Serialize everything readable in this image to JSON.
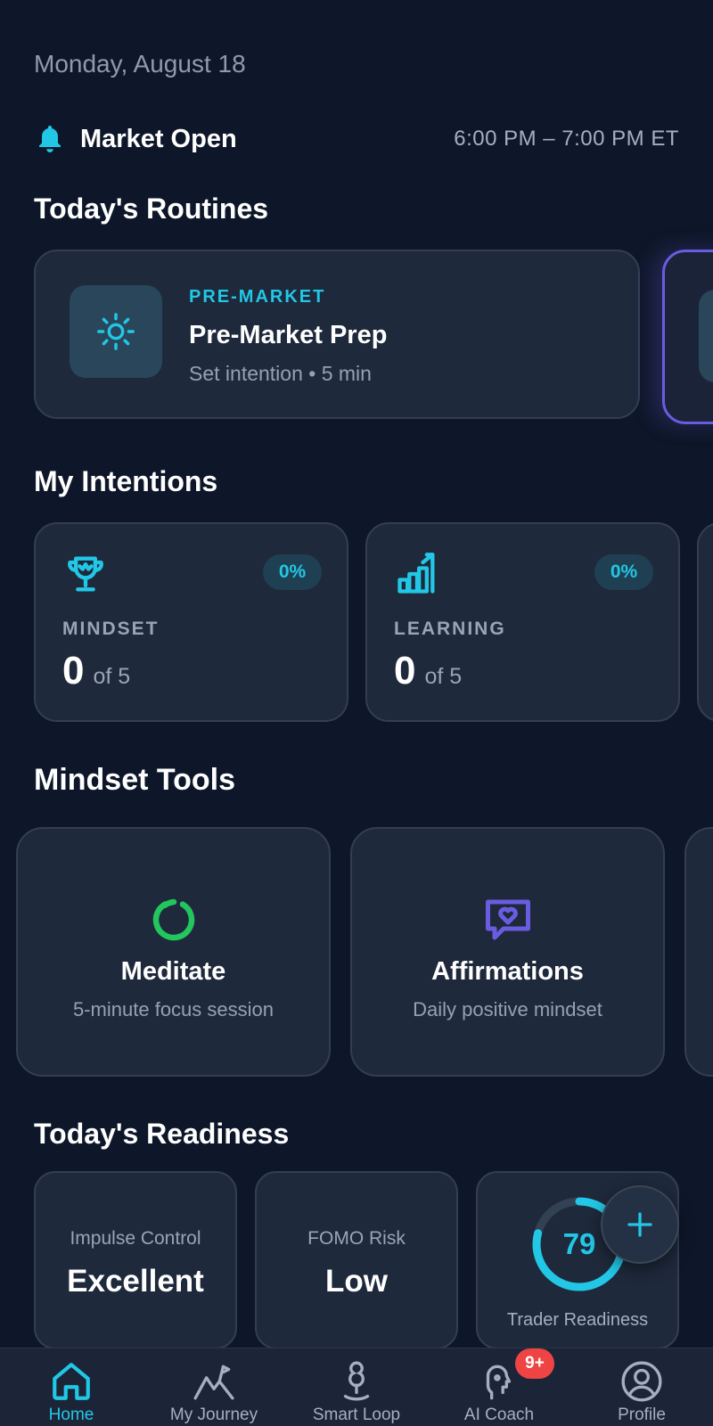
{
  "header": {
    "date": "Monday, August 18"
  },
  "market": {
    "icon": "bell-icon",
    "status": "Market Open",
    "time_range": "6:00 PM – 7:00 PM ET"
  },
  "routines": {
    "title": "Today's Routines",
    "items": [
      {
        "tag": "PRE-MARKET",
        "title": "Pre-Market Prep",
        "subtitle": "Set intention • 5 min",
        "icon": "sun-icon"
      }
    ]
  },
  "intentions": {
    "title": "My Intentions",
    "items": [
      {
        "label": "MINDSET",
        "value": "0",
        "of_text": "of 5",
        "percent": "0%",
        "icon": "trophy-icon"
      },
      {
        "label": "LEARNING",
        "value": "0",
        "of_text": "of 5",
        "percent": "0%",
        "icon": "growth-chart-icon"
      }
    ]
  },
  "tools": {
    "title": "Mindset Tools",
    "items": [
      {
        "title": "Meditate",
        "subtitle": "5-minute focus session",
        "icon": "meditate-ring-icon"
      },
      {
        "title": "Affirmations",
        "subtitle": "Daily positive mindset",
        "icon": "heart-chat-icon"
      }
    ]
  },
  "readiness": {
    "title": "Today's Readiness",
    "impulse": {
      "label": "Impulse Control",
      "value": "Excellent"
    },
    "fomo": {
      "label": "FOMO Risk",
      "value": "Low"
    },
    "trader": {
      "label": "Trader Readiness",
      "score": "79",
      "score_fraction": 0.79
    }
  },
  "fab": {
    "icon": "plus-icon"
  },
  "nav": {
    "items": [
      {
        "label": "Home",
        "icon": "home-icon",
        "active": true
      },
      {
        "label": "My Journey",
        "icon": "journey-icon"
      },
      {
        "label": "Smart Loop",
        "icon": "smart-loop-icon"
      },
      {
        "label": "AI Coach",
        "icon": "ai-coach-icon",
        "badge": "9+"
      },
      {
        "label": "Profile",
        "icon": "profile-icon"
      }
    ]
  },
  "colors": {
    "background": "#0e1729",
    "card": "#1e293b",
    "accent": "#22c7e6",
    "purple": "#6a5ce0",
    "green": "#22c55e",
    "badge": "#ef4444"
  }
}
